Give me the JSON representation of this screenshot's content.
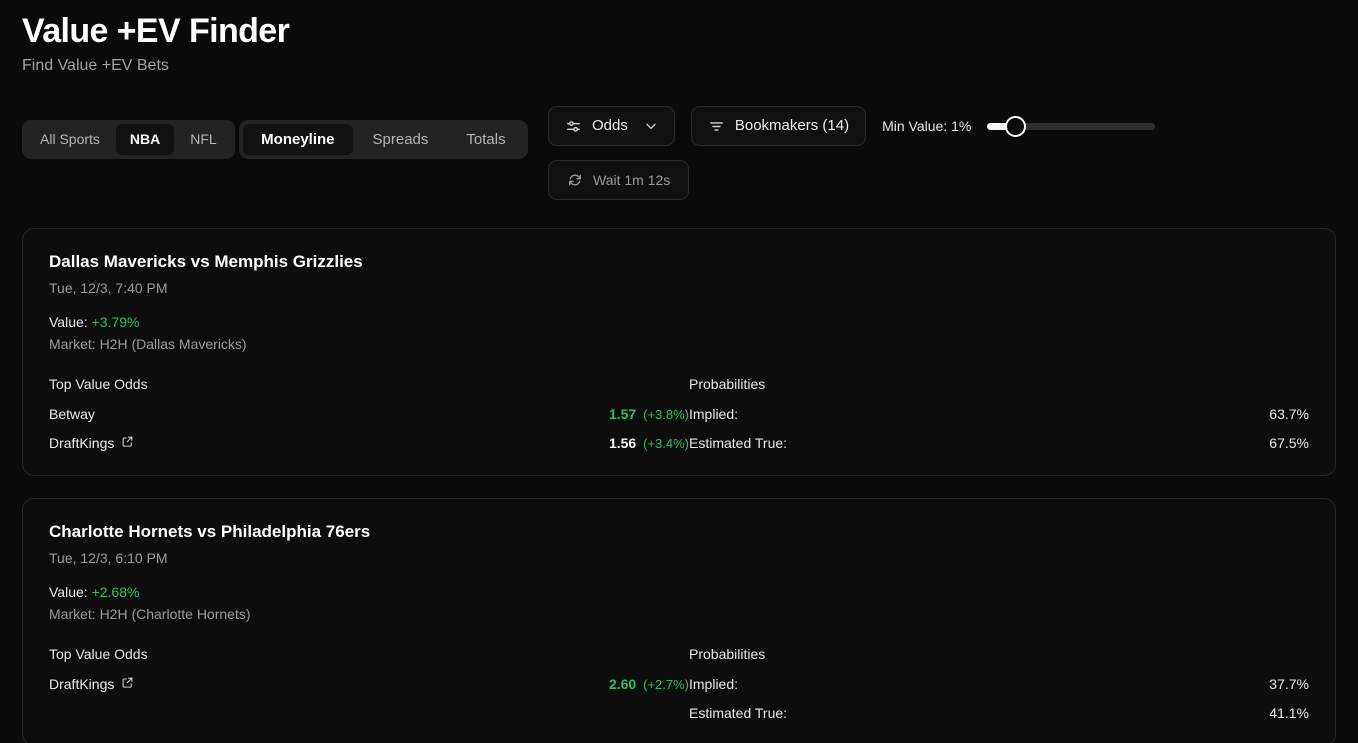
{
  "header": {
    "title": "Value +EV Finder",
    "subtitle": "Find Value +EV Bets"
  },
  "filters": {
    "sports": [
      {
        "label": "All Sports",
        "active": false
      },
      {
        "label": "NBA",
        "active": true
      },
      {
        "label": "NFL",
        "active": false
      }
    ],
    "markets": [
      {
        "label": "Moneyline",
        "active": true
      },
      {
        "label": "Spreads",
        "active": false
      },
      {
        "label": "Totals",
        "active": false
      }
    ],
    "odds_button": {
      "label": "Odds",
      "icon": "sliders-icon",
      "chevron": "chevron-down-icon"
    },
    "bookmakers_button": {
      "label": "Bookmakers (14)",
      "icon": "filter-icon"
    },
    "refresh_button": {
      "label": "Wait 1m 12s",
      "icon": "refresh-icon"
    },
    "min_value": {
      "label": "Min Value: 1%",
      "percent": 1
    }
  },
  "cards": [
    {
      "title": "Dallas Mavericks vs Memphis Grizzlies",
      "datetime": "Tue, 12/3, 7:40 PM",
      "value_label": "Value:",
      "value_pct": "+3.79%",
      "market": "Market: H2H (Dallas Mavericks)",
      "odds_heading": "Top Value Odds",
      "odds": [
        {
          "book": "DallasBook",
          "name": "Betway",
          "link": false,
          "price": "1.57",
          "edge": "(+3.8%)",
          "highlight": "green"
        },
        {
          "book": "DallasBook2",
          "name": "DraftKings",
          "link": true,
          "price": "1.56",
          "edge": "(+3.4%)",
          "highlight": "white"
        }
      ],
      "prob_heading": "Probabilities",
      "probabilities": [
        {
          "label": "Implied:",
          "value": "63.7%"
        },
        {
          "label": "Estimated True:",
          "value": "67.5%"
        }
      ]
    },
    {
      "title": "Charlotte Hornets vs Philadelphia 76ers",
      "datetime": "Tue, 12/3, 6:10 PM",
      "value_label": "Value:",
      "value_pct": "+2.68%",
      "market": "Market: H2H (Charlotte Hornets)",
      "odds_heading": "Top Value Odds",
      "odds": [
        {
          "book": "CharlotteBook",
          "name": "DraftKings",
          "link": true,
          "price": "2.60",
          "edge": "(+2.7%)",
          "highlight": "green"
        }
      ],
      "prob_heading": "Probabilities",
      "probabilities": [
        {
          "label": "Implied:",
          "value": "37.7%"
        },
        {
          "label": "Estimated True:",
          "value": "41.1%"
        }
      ]
    }
  ],
  "colors": {
    "background": "#0a0a0a",
    "card_background": "#0d0d0d",
    "card_border": "#272727",
    "accent_green": "#2fbf5f",
    "text_primary": "#fafafa",
    "text_muted": "#9b9b9b"
  }
}
